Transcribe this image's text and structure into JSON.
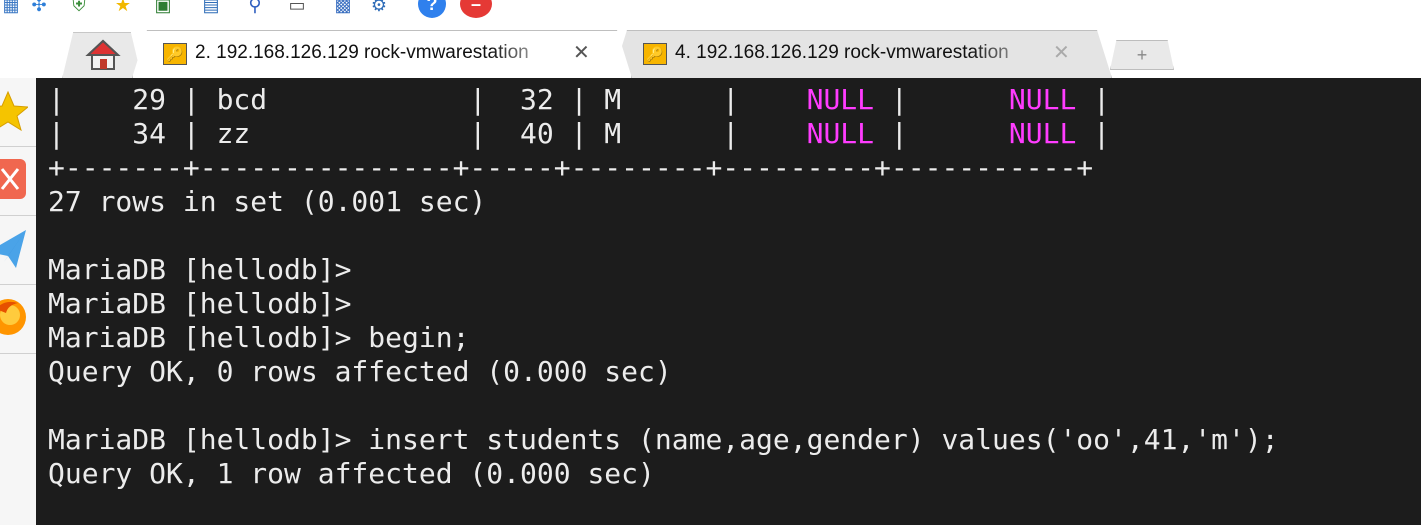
{
  "toolbar": {
    "icons": [
      "grid-icon",
      "network-icon",
      "shield-icon",
      "star-icon",
      "monitor-user-icon",
      "monitor-icon",
      "pin-icon",
      "monitor-network-icon",
      "image-icon",
      "gear-icon",
      "help-icon",
      "stop-icon"
    ]
  },
  "tabs": [
    {
      "title": "2. 192.168.126.129 rock-vmwarestation",
      "close": "✕",
      "active": true
    },
    {
      "title": "4. 192.168.126.129 rock-vmwarestation",
      "close": "✕",
      "active": false
    }
  ],
  "new_tab": "+",
  "sidebar": {
    "icons": [
      "star-icon",
      "cut-icon",
      "send-icon",
      "firefox-icon"
    ]
  },
  "terminal": {
    "table_rows": [
      {
        "pre": "|    29 | bcd            |  32 | M      |    ",
        "null1": "NULL",
        "mid": " |      ",
        "null2": "NULL",
        "post": " |"
      },
      {
        "pre": "|    34 | zz             |  40 | M      |    ",
        "null1": "NULL",
        "mid": " |      ",
        "null2": "NULL",
        "post": " |"
      }
    ],
    "separator": "+-------+---------------+-----+--------+---------+-----------+",
    "lines": [
      "27 rows in set (0.001 sec)",
      "",
      "MariaDB [hellodb]>",
      "MariaDB [hellodb]>",
      "MariaDB [hellodb]> begin;",
      "Query OK, 0 rows affected (0.000 sec)",
      "",
      "MariaDB [hellodb]> insert students (name,age,gender) values('oo',41,'m');",
      "Query OK, 1 row affected (0.000 sec)"
    ]
  }
}
